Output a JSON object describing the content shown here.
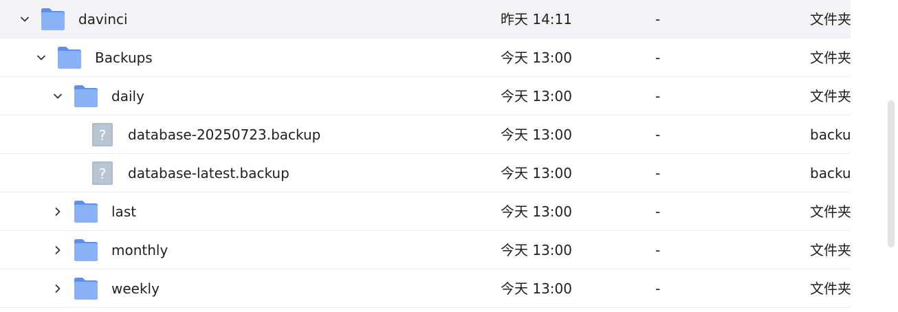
{
  "rows": [
    {
      "name": "davinci",
      "date": "昨天 14:11",
      "size": "-",
      "type": "文件夹",
      "icon": "folder-icon",
      "chevron": "chevron-down-icon",
      "selected": true
    },
    {
      "name": "Backups",
      "date": "今天 13:00",
      "size": "-",
      "type": "文件夹",
      "icon": "folder-icon",
      "chevron": "chevron-down-icon"
    },
    {
      "name": "daily",
      "date": "今天 13:00",
      "size": "-",
      "type": "文件夹",
      "icon": "folder-icon",
      "chevron": "chevron-down-icon"
    },
    {
      "name": "database-20250723.backup",
      "date": "今天 13:00",
      "size": "-",
      "type": "backup",
      "icon": "unknown-file-icon"
    },
    {
      "name": "database-latest.backup",
      "date": "今天 13:00",
      "size": "-",
      "type": "backup",
      "icon": "unknown-file-icon"
    },
    {
      "name": "last",
      "date": "今天 13:00",
      "size": "-",
      "type": "文件夹",
      "icon": "folder-icon",
      "chevron": "chevron-right-icon"
    },
    {
      "name": "monthly",
      "date": "今天 13:00",
      "size": "-",
      "type": "文件夹",
      "icon": "folder-icon",
      "chevron": "chevron-right-icon"
    },
    {
      "name": "weekly",
      "date": "今天 13:00",
      "size": "-",
      "type": "文件夹",
      "icon": "folder-icon",
      "chevron": "chevron-right-icon"
    }
  ],
  "colors": {
    "folder": "#7aa7f5",
    "folder_tab": "#5f8fe8",
    "unknown_file": "#aebbc9",
    "selected_row": "#f3f3f6"
  }
}
